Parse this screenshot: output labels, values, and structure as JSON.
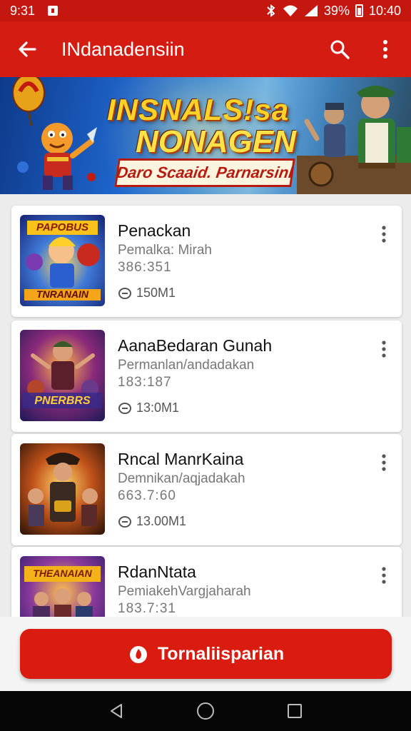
{
  "status_bar": {
    "time_left": "9:31",
    "battery": "39%",
    "time_right": "10:40"
  },
  "app_bar": {
    "title": "INdanadensiin",
    "back_icon": "arrow-left-icon",
    "search_icon": "search-icon",
    "more_icon": "more-vert-icon"
  },
  "banner": {
    "title_line1": "INSNALS!sa",
    "title_line2": "NONAGEN",
    "subtitle": "Daro Scaaid. Parnarsinl"
  },
  "games": [
    {
      "title": "Penackan",
      "subtitle": "Pemalka: Mirah",
      "number": "386:351",
      "size": "150M1"
    },
    {
      "title": "AanaBedaran Gunah",
      "subtitle": "Permanlan/andadakan",
      "number": "183:187",
      "size": "13:0M1"
    },
    {
      "title": "Rncal ManrKaina",
      "subtitle": "Demnikan/aqjadakah",
      "number": "663.7:60",
      "size": "13.00M1"
    },
    {
      "title": "RdanNtata",
      "subtitle": "PemiakehVargjaharah",
      "number": "183.7:31",
      "size": ""
    }
  ],
  "thumb_labels": [
    "PAPOBUS",
    "TNRANAIN",
    "PNERBRS",
    "THEANAIAN"
  ],
  "cta": {
    "label": "Tornaliisparian",
    "icon": "flame-icon"
  },
  "colors": {
    "primary": "#d51c12",
    "status": "#c4170f",
    "button": "#d91b10"
  }
}
